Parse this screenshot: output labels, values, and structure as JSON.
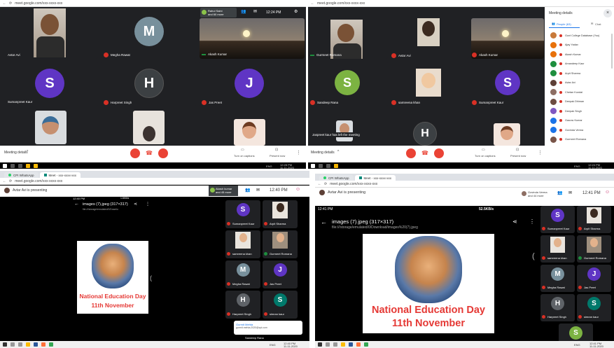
{
  "colors": {
    "dark": "#1f1f1f",
    "tile": "#3c4043",
    "red": "#ea4335",
    "green": "#34a853",
    "purple": "#5f35c4"
  },
  "q1": {
    "url": "meet.google.com/xxx-xxxx-xxx",
    "clock": "12:24 PM",
    "sharing": {
      "name": "Rahul Saini",
      "more": "and 60 more"
    },
    "tiles": [
      {
        "name": "Avtar Avi"
      },
      {
        "name": "Megha Rawat",
        "letter": "M"
      },
      {
        "name": "Akash Kumar"
      },
      {
        "name": "Sumanpreet Kaur",
        "letter": "S"
      },
      {
        "name": "Harpreet Singh",
        "letter": "H"
      },
      {
        "name": "Jas Preet",
        "letter": "J"
      }
    ],
    "meeting_details": "Meeting details",
    "captions": "Turn on captions",
    "present": "Present now"
  },
  "q2": {
    "url": "meet.google.com/xxx-xxxx-xxx",
    "tiles": [
      {
        "name": "Gurmeet Romana"
      },
      {
        "name": "Avtar Avi"
      },
      {
        "name": "Akash Kumar"
      },
      {
        "name": "Sandeep Rana",
        "letter": "S"
      },
      {
        "name": "samreena khan"
      },
      {
        "name": "Sumanpreet Kaur",
        "letter": "S"
      },
      {
        "name": "",
        "letter": "H"
      }
    ],
    "left_msg": "Jaspreet kaur has left the meeting",
    "meeting_details": "Meeting details",
    "captions": "Turn on captions",
    "present": "Present now",
    "panel": {
      "title": "Meeting details",
      "tab_people": "People (63)",
      "tab_chat": "Chat",
      "people": [
        {
          "name": "Govt College Database (You)",
          "color": "#c87a3a"
        },
        {
          "name": "Ajay Yadav",
          "color": "#e8710a"
        },
        {
          "name": "Akash Kumar",
          "color": "#e8710a"
        },
        {
          "name": "Amandeep Kaur",
          "color": "#1e8e3e"
        },
        {
          "name": "Arpit Sharma",
          "color": "#1e8e3e"
        },
        {
          "name": "Avtar Avi",
          "color": "#5d4037"
        },
        {
          "name": "Chetan Kundal",
          "color": "#8d6e63"
        },
        {
          "name": "Deepak Dhiman",
          "color": "#6d4c41"
        },
        {
          "name": "Deepak Singh",
          "color": "#7e57c2"
        },
        {
          "name": "Gaurav Kumar",
          "color": "#1a73e8"
        },
        {
          "name": "Govinda Verma",
          "color": "#1a73e8"
        },
        {
          "name": "Gurmeet Romana",
          "color": "#795548"
        }
      ]
    }
  },
  "q3": {
    "tabs": [
      "CPI WhatsApp",
      "Meet - xxx-xxxx-xxx"
    ],
    "url": "meet.google.com/xxx-xxxx-xxx",
    "presenting": "Avtar Avi is presenting",
    "sharing": {
      "name": "Akash kumar",
      "more": "and 45 more"
    },
    "clock": "12:40 PM",
    "phone_time": "12:40 PM",
    "phone_status": "1.8KB/s",
    "file_title": "images (7).jpeg (317×317)",
    "file_path": "file:///storage/emulated/0/Downlo",
    "poster_line1": "National Education Day",
    "poster_line2": "11th November",
    "tiles": [
      {
        "name": "Sumanpreet Kaur",
        "letter": "S"
      },
      {
        "name": "Arpit Sharma"
      },
      {
        "name": "samreena khan"
      },
      {
        "name": "Gurmeet Romana"
      },
      {
        "name": "Megha Rawat",
        "letter": "M"
      },
      {
        "name": "Jas Preet",
        "letter": "J"
      },
      {
        "name": "Harpreet Singh",
        "letter": "H"
      },
      {
        "name": "simran kaur",
        "letter": "S"
      }
    ],
    "notif": {
      "name": "Gurmit Mehta",
      "text": "gurmit.mehta.2020@cpi.com"
    },
    "notif_bottom": "Sandeep Rana"
  },
  "q4": {
    "tabs": [
      "CPI WhatsApp",
      "Meet - xxx-xxxx-xxx"
    ],
    "url": "meet.google.com/xxx-xxxx-xxx",
    "presenting": "Avtar Avi is presenting",
    "sharing": {
      "name": "Govinda Verma",
      "more": "and 44 more"
    },
    "clock": "12:41 PM",
    "phone_time": "12:41 PM",
    "phone_status": "52.5KB/s",
    "file_title": "images (7).jpeg (317×317)",
    "file_path": "file:///storage/emulated/0/Download/images%20(7).jpeg",
    "poster_line1": "National Education Day",
    "poster_line2": "11th November",
    "tiles": [
      {
        "name": "Sumanpreet Kaur",
        "letter": "S"
      },
      {
        "name": "Arpit Sharma"
      },
      {
        "name": "samreena khan"
      },
      {
        "name": "Gurmeet Romana"
      },
      {
        "name": "Megha Rawat",
        "letter": "M"
      },
      {
        "name": "Jas Preet",
        "letter": "J"
      },
      {
        "name": "Harpreet Singh",
        "letter": "H"
      },
      {
        "name": "simran kaur",
        "letter": "S"
      },
      {
        "name": "Sandeep Rana",
        "letter": "S"
      }
    ]
  },
  "taskbar": {
    "lang": "ENG",
    "date": "11-11-2020",
    "t1": "12:24 PM",
    "t2": "12:28 PM",
    "t3": "12:40 PM",
    "t4": "12:41 PM"
  }
}
